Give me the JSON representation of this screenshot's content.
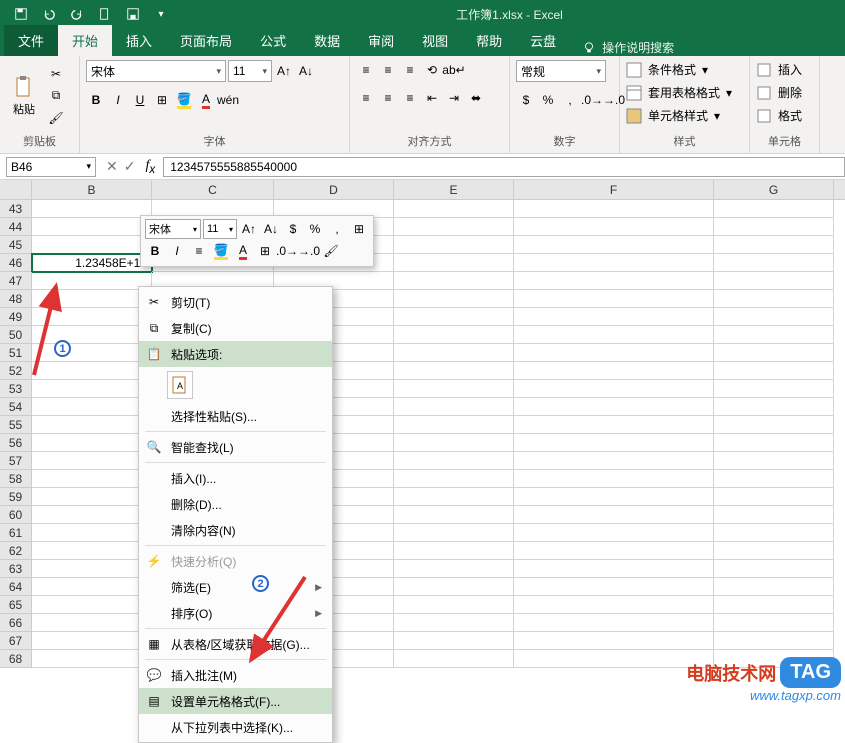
{
  "title": "工作簿1.xlsx - Excel",
  "tabs": {
    "file": "文件",
    "home": "开始",
    "insert": "插入",
    "layout": "页面布局",
    "formulas": "公式",
    "data": "数据",
    "review": "审阅",
    "view": "视图",
    "help": "帮助",
    "cloud": "云盘",
    "tellme": "操作说明搜索"
  },
  "groups": {
    "clipboard": {
      "label": "剪贴板",
      "paste": "粘贴"
    },
    "font": {
      "label": "字体",
      "family": "宋体",
      "size": "11"
    },
    "align": {
      "label": "对齐方式"
    },
    "number": {
      "label": "数字",
      "format": "常规"
    },
    "styles": {
      "label": "样式",
      "cond": "条件格式",
      "table": "套用表格格式",
      "cell": "单元格样式"
    },
    "cells": {
      "label": "单元格",
      "insert": "插入",
      "delete": "删除",
      "format": "格式"
    }
  },
  "namebox": "B46",
  "formula": "1234575555885540000",
  "columns": [
    "B",
    "C",
    "D",
    "E",
    "F",
    "G"
  ],
  "rows": [
    43,
    44,
    45,
    46,
    47,
    48,
    49,
    50,
    51,
    52,
    53,
    54,
    55,
    56,
    57,
    58,
    59,
    60,
    61,
    62,
    63,
    64,
    65,
    66,
    67,
    68
  ],
  "cellB46": "1.23458E+18",
  "miniToolbar": {
    "font": "宋体",
    "size": "11"
  },
  "contextMenu": {
    "cut": "剪切(T)",
    "copy": "复制(C)",
    "pasteOptions": "粘贴选项:",
    "pasteSpecial": "选择性粘贴(S)...",
    "smartLookup": "智能查找(L)",
    "insert": "插入(I)...",
    "delete": "删除(D)...",
    "clear": "清除内容(N)",
    "quick": "快速分析(Q)",
    "filter": "筛选(E)",
    "sort": "排序(O)",
    "tableRange": "从表格/区域获取数据(G)...",
    "comment": "插入批注(M)",
    "formatCells": "设置单元格格式(F)...",
    "pickList": "从下拉列表中选择(K)..."
  },
  "watermark": {
    "brand": "电脑技术网",
    "tag": "TAG",
    "url": "www.tagxp.com"
  }
}
